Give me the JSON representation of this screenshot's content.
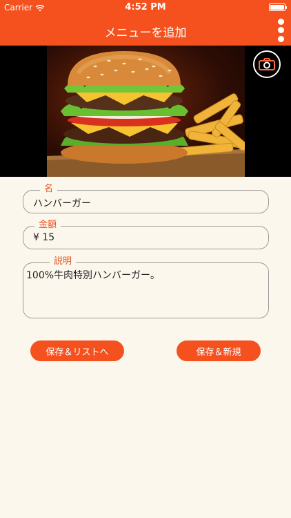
{
  "status_bar": {
    "carrier": "Carrier",
    "time": "4:52 PM",
    "icons": [
      "wifi-icon",
      "battery-icon"
    ]
  },
  "nav": {
    "title": "メニューを追加",
    "more_icon": "more-vertical-icon"
  },
  "hero": {
    "image": "hamburger-and-fries-photo",
    "camera_icon": "camera-icon"
  },
  "form": {
    "name": {
      "label": "名",
      "value": "ハンバーガー"
    },
    "price": {
      "label": "金額",
      "value": "¥ 15"
    },
    "description": {
      "label": "説明",
      "value": "100%牛肉特別ハンバーガー。"
    }
  },
  "buttons": {
    "save_to_list": "保存＆リストへ",
    "save_and_new": "保存＆新規"
  },
  "colors": {
    "accent": "#f4511e",
    "background": "#fbf7ec",
    "label": "#e8531f",
    "border": "#9a9a9a"
  }
}
